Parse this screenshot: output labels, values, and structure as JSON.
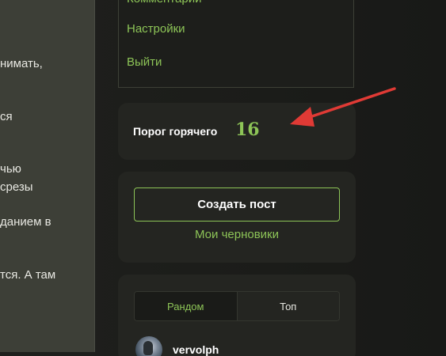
{
  "article": {
    "lines": [
      "нимать,",
      "ся",
      "чью",
      "срезы",
      "данием в",
      "тся. А там"
    ]
  },
  "menu": {
    "items": [
      {
        "label": "Комментарии"
      },
      {
        "label": "Настройки"
      },
      {
        "label": "Выйти"
      }
    ]
  },
  "hot": {
    "label": "Порог горячего",
    "value": "16"
  },
  "create": {
    "button_label": "Создать пост",
    "drafts_label": "Мои черновики"
  },
  "tabs": {
    "items": [
      {
        "label": "Рандом",
        "active": true
      },
      {
        "label": "Топ",
        "active": false
      }
    ]
  },
  "user": {
    "name": "vervolph"
  },
  "colors": {
    "accent": "#8dc457",
    "background": "#1b1c19",
    "card": "#242521",
    "annotation_arrow": "#e03a35"
  }
}
